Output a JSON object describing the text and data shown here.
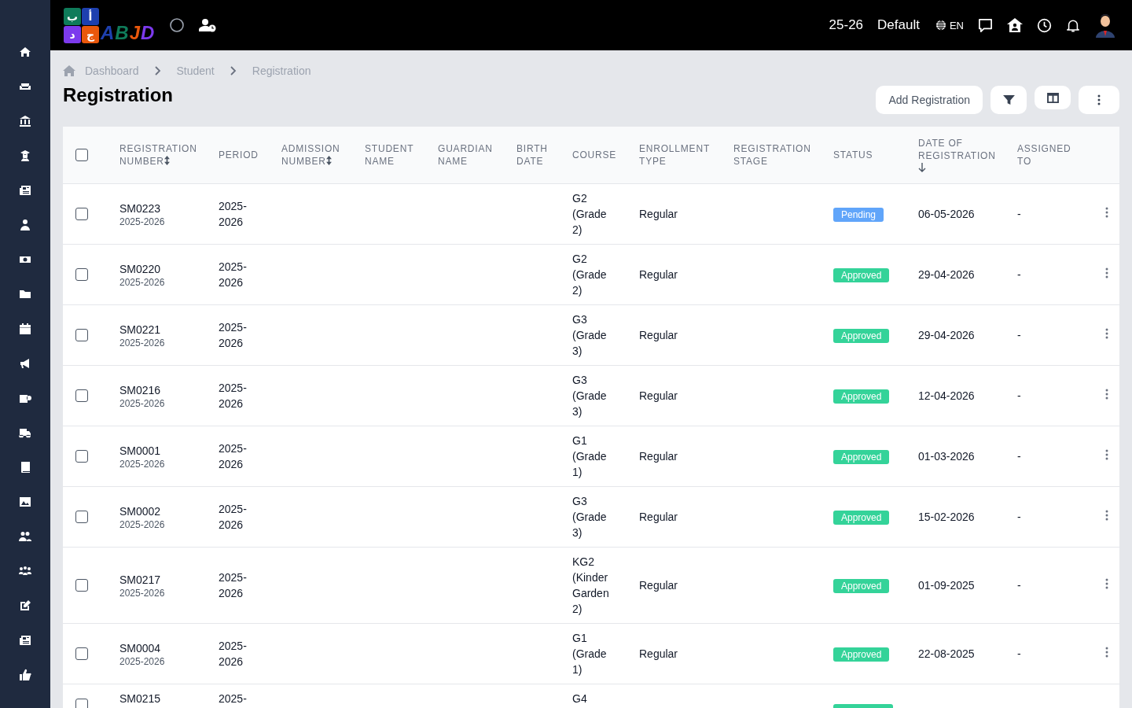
{
  "logo": {
    "tiles": [
      {
        "letter": "ب",
        "color": "#0f7b5a"
      },
      {
        "letter": "د",
        "color": "#7c3aed"
      },
      {
        "letter": "أ",
        "color": "#1e40af"
      },
      {
        "letter": "ج",
        "color": "#ea580c"
      }
    ],
    "wordmark": [
      {
        "letter": "A",
        "color": "#1e40af"
      },
      {
        "letter": "B",
        "color": "#0f7b5a"
      },
      {
        "letter": "J",
        "color": "#ea580c"
      },
      {
        "letter": "D",
        "color": "#7c3aed"
      }
    ]
  },
  "topbar": {
    "year": "25-26",
    "profile": "Default",
    "language": "EN"
  },
  "breadcrumb": [
    "Dashboard",
    "Student",
    "Registration"
  ],
  "page_title": "Registration",
  "actions": {
    "add_button": "Add Registration"
  },
  "table": {
    "select_all_checked": false,
    "columns": [
      {
        "label": "REGISTRATION NUMBER",
        "sortable": true,
        "sorted_descending": false
      },
      {
        "label": "PERIOD",
        "sortable": false,
        "sorted_descending": false
      },
      {
        "label": "ADMISSION NUMBER",
        "sortable": true,
        "sorted_descending": false
      },
      {
        "label": "STUDENT NAME",
        "sortable": false,
        "sorted_descending": false
      },
      {
        "label": "GUARDIAN NAME",
        "sortable": false,
        "sorted_descending": false
      },
      {
        "label": "BIRTH DATE",
        "sortable": false,
        "sorted_descending": false
      },
      {
        "label": "COURSE",
        "sortable": false,
        "sorted_descending": false
      },
      {
        "label": "ENROLLMENT TYPE",
        "sortable": false,
        "sorted_descending": false
      },
      {
        "label": "REGISTRATION STAGE",
        "sortable": false,
        "sorted_descending": false
      },
      {
        "label": "STATUS",
        "sortable": false,
        "sorted_descending": false
      },
      {
        "label": "DATE OF REGISTRATION",
        "sortable": false,
        "sorted_descending": true
      },
      {
        "label": "ASSIGNED TO",
        "sortable": false,
        "sorted_descending": false
      }
    ],
    "rows": [
      {
        "checked": false,
        "registration_number": "SM0223",
        "sub": "2025-2026",
        "period": "2025-2026",
        "course": "G2 (Grade 2)",
        "enrollment": "Regular",
        "status": {
          "kind": "pending",
          "label": "Pending"
        },
        "date": "06-05-2026",
        "assigned": "-"
      },
      {
        "checked": false,
        "registration_number": "SM0220",
        "sub": "2025-2026",
        "period": "2025-2026",
        "course": "G2 (Grade 2)",
        "enrollment": "Regular",
        "status": {
          "kind": "approved",
          "label": "Approved"
        },
        "date": "29-04-2026",
        "assigned": "-"
      },
      {
        "checked": false,
        "registration_number": "SM0221",
        "sub": "2025-2026",
        "period": "2025-2026",
        "course": "G3 (Grade 3)",
        "enrollment": "Regular",
        "status": {
          "kind": "approved",
          "label": "Approved"
        },
        "date": "29-04-2026",
        "assigned": "-"
      },
      {
        "checked": false,
        "registration_number": "SM0216",
        "sub": "2025-2026",
        "period": "2025-2026",
        "course": "G3 (Grade 3)",
        "enrollment": "Regular",
        "status": {
          "kind": "approved",
          "label": "Approved"
        },
        "date": "12-04-2026",
        "assigned": "-"
      },
      {
        "checked": false,
        "registration_number": "SM0001",
        "sub": "2025-2026",
        "period": "2025-2026",
        "course": "G1 (Grade 1)",
        "enrollment": "Regular",
        "status": {
          "kind": "approved",
          "label": "Approved"
        },
        "date": "01-03-2026",
        "assigned": "-"
      },
      {
        "checked": false,
        "registration_number": "SM0002",
        "sub": "2025-2026",
        "period": "2025-2026",
        "course": "G3 (Grade 3)",
        "enrollment": "Regular",
        "status": {
          "kind": "approved",
          "label": "Approved"
        },
        "date": "15-02-2026",
        "assigned": "-"
      },
      {
        "checked": false,
        "registration_number": "SM0217",
        "sub": "2025-2026",
        "period": "2025-2026",
        "course": "KG2 (Kinder Garden 2)",
        "enrollment": "Regular",
        "status": {
          "kind": "approved",
          "label": "Approved"
        },
        "date": "01-09-2025",
        "assigned": "-"
      },
      {
        "checked": false,
        "registration_number": "SM0004",
        "sub": "2025-2026",
        "period": "2025-2026",
        "course": "G1 (Grade 1)",
        "enrollment": "Regular",
        "status": {
          "kind": "approved",
          "label": "Approved"
        },
        "date": "22-08-2025",
        "assigned": "-"
      },
      {
        "checked": false,
        "registration_number": "SM0215",
        "period": "2025-",
        "course": "G4",
        "status": {
          "kind": "approved"
        }
      }
    ]
  }
}
